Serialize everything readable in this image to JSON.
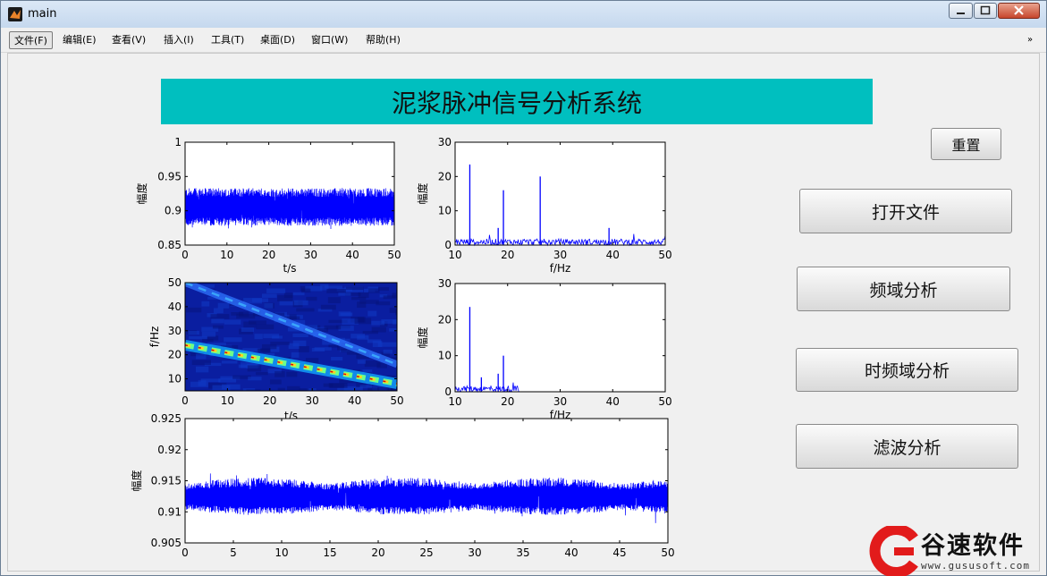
{
  "window": {
    "title": "main"
  },
  "menu": [
    "文件(F)",
    "编辑(E)",
    "查看(V)",
    "插入(I)",
    "工具(T)",
    "桌面(D)",
    "窗口(W)",
    "帮助(H)"
  ],
  "menu_overflow_icon": "double-chevron-icon",
  "header": {
    "title": "泥浆脉冲信号分析系统"
  },
  "buttons": {
    "reset": "重置",
    "open_file": "打开文件",
    "freq": "频域分析",
    "tf": "时频域分析",
    "filter": "滤波分析"
  },
  "watermark": {
    "text": "谷速软件",
    "url": "www.gususoft.com"
  },
  "colors": {
    "banner": "#00bfbf",
    "signal": "#0000ff",
    "spectrogram_bg": "#0a1ea0"
  },
  "chart_data": [
    {
      "type": "line",
      "ylabel": "幅度",
      "xlabel": "t/s",
      "xlim": [
        0,
        50
      ],
      "ylim": [
        0.85,
        1
      ],
      "xticks": [
        0,
        10,
        20,
        30,
        40,
        50
      ],
      "yticks": [
        0.85,
        0.9,
        0.95,
        1
      ],
      "ytick_labels": [
        "0.85",
        "0.9",
        "0.95",
        "1"
      ],
      "series": [
        {
          "description": "dense noisy signal band",
          "center": 0.905,
          "lower": 0.878,
          "upper": 0.933
        }
      ]
    },
    {
      "type": "line",
      "ylabel": "幅度",
      "xlabel": "f/Hz",
      "xlim": [
        10,
        50
      ],
      "ylim": [
        0,
        30
      ],
      "xticks": [
        10,
        20,
        30,
        40,
        50
      ],
      "yticks": [
        0,
        10,
        20,
        30
      ],
      "ytick_labels": [
        "0",
        "10",
        "20",
        "30"
      ],
      "peaks": [
        {
          "x": 12.8,
          "y": 23.5
        },
        {
          "x": 19.2,
          "y": 16
        },
        {
          "x": 26.2,
          "y": 20
        },
        {
          "x": 18.2,
          "y": 5
        },
        {
          "x": 39.3,
          "y": 5
        }
      ]
    },
    {
      "type": "heatmap",
      "ylabel": "f/Hz",
      "xlabel": "t/s",
      "xlim": [
        0,
        50
      ],
      "ylim": [
        5,
        50
      ],
      "xticks": [
        0,
        10,
        20,
        30,
        40,
        50
      ],
      "yticks": [
        10,
        20,
        30,
        40,
        50
      ],
      "ytick_labels": [
        "10",
        "20",
        "30",
        "40",
        "50"
      ],
      "ridges": [
        {
          "from": [
            0,
            24
          ],
          "to": [
            50,
            8
          ],
          "intensity": "high"
        },
        {
          "from": [
            0,
            50
          ],
          "to": [
            50,
            16
          ],
          "intensity": "low"
        }
      ]
    },
    {
      "type": "line",
      "ylabel": "幅度",
      "xlabel": "f/Hz",
      "xlim": [
        10,
        50
      ],
      "ylim": [
        0,
        30
      ],
      "xticks": [
        10,
        20,
        30,
        40,
        50
      ],
      "yticks": [
        0,
        10,
        20,
        30
      ],
      "ytick_labels": [
        "0",
        "10",
        "20",
        "30"
      ],
      "peaks": [
        {
          "x": 12.8,
          "y": 23.5
        },
        {
          "x": 19.2,
          "y": 10
        },
        {
          "x": 18.2,
          "y": 5
        },
        {
          "x": 15,
          "y": 4
        }
      ]
    },
    {
      "type": "line",
      "ylabel": "幅度",
      "xlabel": "",
      "xlim": [
        0,
        50
      ],
      "ylim": [
        0.905,
        0.925
      ],
      "xticks": [
        0,
        5,
        10,
        15,
        20,
        25,
        30,
        35,
        40,
        45,
        50
      ],
      "yticks": [
        0.905,
        0.91,
        0.915,
        0.92,
        0.925
      ],
      "ytick_labels": [
        "0.905",
        "0.91",
        "0.915",
        "0.92",
        "0.925"
      ],
      "series": [
        {
          "description": "filtered noisy signal",
          "center": 0.9123,
          "lower": 0.9095,
          "upper": 0.9155
        }
      ]
    }
  ]
}
